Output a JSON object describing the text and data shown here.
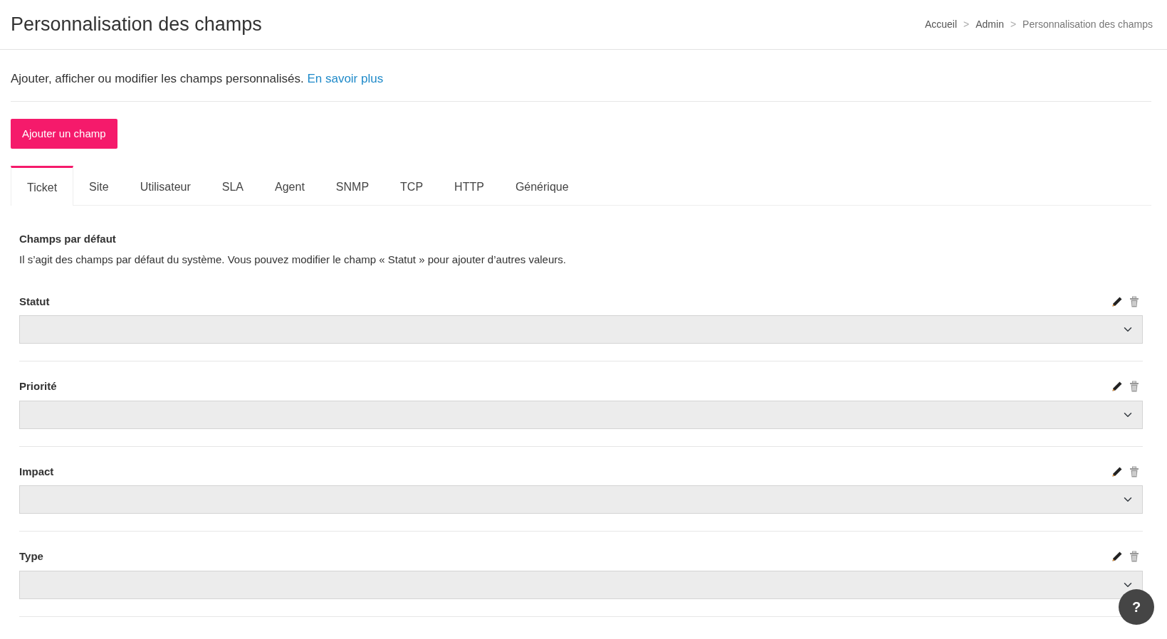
{
  "header": {
    "title": "Personnalisation des champs",
    "breadcrumb_separator": ">",
    "breadcrumb": [
      {
        "label": "Accueil",
        "current": false
      },
      {
        "label": "Admin",
        "current": false
      },
      {
        "label": "Personnalisation des champs",
        "current": true
      }
    ]
  },
  "intro": {
    "text": "Ajouter, afficher ou modifier les champs personnalisés.",
    "link": "En savoir plus"
  },
  "add_button": "Ajouter un champ",
  "tabs": [
    {
      "label": "Ticket",
      "selected": true
    },
    {
      "label": "Site",
      "selected": false
    },
    {
      "label": "Utilisateur",
      "selected": false
    },
    {
      "label": "SLA",
      "selected": false
    },
    {
      "label": "Agent",
      "selected": false
    },
    {
      "label": "SNMP",
      "selected": false
    },
    {
      "label": "TCP",
      "selected": false
    },
    {
      "label": "HTTP",
      "selected": false
    },
    {
      "label": "Générique",
      "selected": false
    }
  ],
  "section": {
    "title": "Champs par défaut",
    "description": "Il s’agit des champs par défaut du système. Vous pouvez modifier le champ « Statut » pour ajouter d’autres valeurs.",
    "fields": [
      {
        "label": "Statut"
      },
      {
        "label": "Priorité"
      },
      {
        "label": "Impact"
      },
      {
        "label": "Type"
      }
    ]
  },
  "help_button": "?"
}
